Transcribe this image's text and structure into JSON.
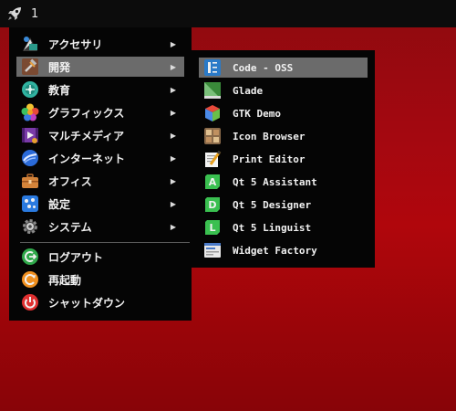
{
  "panel": {
    "launcher_icon": "rocket-icon",
    "workspace": "1"
  },
  "menu": {
    "items": [
      {
        "label": "アクセサリ",
        "icon": "accessories-icon",
        "has_submenu": true
      },
      {
        "label": "開発",
        "icon": "development-icon",
        "has_submenu": true,
        "active": true
      },
      {
        "label": "教育",
        "icon": "education-icon",
        "has_submenu": true
      },
      {
        "label": "グラフィックス",
        "icon": "graphics-icon",
        "has_submenu": true
      },
      {
        "label": "マルチメディア",
        "icon": "multimedia-icon",
        "has_submenu": true
      },
      {
        "label": "インターネット",
        "icon": "internet-icon",
        "has_submenu": true
      },
      {
        "label": "オフィス",
        "icon": "office-icon",
        "has_submenu": true
      },
      {
        "label": "設定",
        "icon": "settings-icon",
        "has_submenu": true
      },
      {
        "label": "システム",
        "icon": "system-icon",
        "has_submenu": true
      }
    ],
    "session": [
      {
        "label": "ログアウト",
        "icon": "logout-icon"
      },
      {
        "label": "再起動",
        "icon": "reboot-icon"
      },
      {
        "label": "シャットダウン",
        "icon": "shutdown-icon"
      }
    ],
    "arrow": "▶"
  },
  "submenu": {
    "items": [
      {
        "label": "Code - OSS",
        "icon": "code-oss-icon",
        "active": true
      },
      {
        "label": "Glade",
        "icon": "glade-icon"
      },
      {
        "label": "GTK Demo",
        "icon": "gtk-demo-icon"
      },
      {
        "label": "Icon Browser",
        "icon": "icon-browser-icon"
      },
      {
        "label": "Print Editor",
        "icon": "print-editor-icon"
      },
      {
        "label": "Qt 5 Assistant",
        "icon": "qt-assistant-icon",
        "letter": "A"
      },
      {
        "label": "Qt 5 Designer",
        "icon": "qt-designer-icon",
        "letter": "D"
      },
      {
        "label": "Qt 5 Linguist",
        "icon": "qt-linguist-icon",
        "letter": "L"
      },
      {
        "label": "Widget Factory",
        "icon": "widget-factory-icon"
      }
    ]
  },
  "colors": {
    "desktop": "#a50810",
    "menu_bg": "#050505",
    "highlight": "#6b6b6b",
    "text": "#f0f0f0"
  }
}
